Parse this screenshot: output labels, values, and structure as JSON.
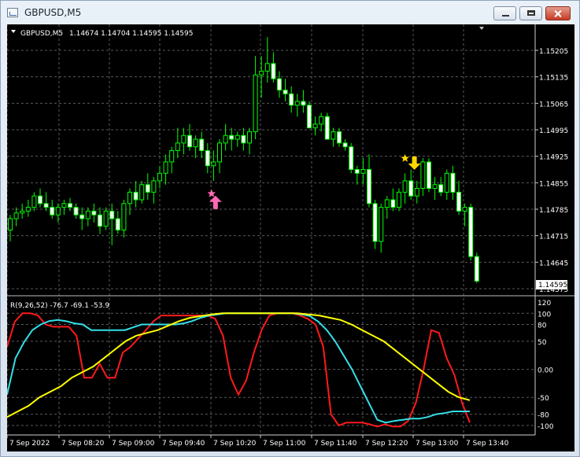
{
  "window": {
    "title": "GBPUSD,M5"
  },
  "colors": {
    "bull": "#00ff00",
    "bear": "#ffffff",
    "red": "#ff1a1a",
    "cyan": "#34e0e8",
    "yellow": "#ffff00",
    "pink": "#ff69b4",
    "gold": "#ffd700"
  },
  "header": {
    "symbol": "GBPUSD,M5",
    "ohlc": "1.14674 1.14704 1.14595 1.14595"
  },
  "price_axis": {
    "labels": [
      "1.15205",
      "1.15135",
      "1.15065",
      "1.14995",
      "1.14925",
      "1.14855",
      "1.14785",
      "1.14715",
      "1.14645",
      "1.14575"
    ],
    "current": "1.14595"
  },
  "indicator": {
    "label": "R(9,26,52) -76.7 -69.1 -53.9",
    "axis_labels": [
      "120",
      "100",
      "80",
      "50",
      "0.00",
      "-50",
      "-80",
      "-100"
    ]
  },
  "time_axis": [
    "7 Sep 2022",
    "7 Sep 08:20",
    "7 Sep 09:00",
    "7 Sep 09:40",
    "7 Sep 10:20",
    "7 Sep 11:00",
    "7 Sep 11:40",
    "7 Sep 12:20",
    "7 Sep 13:00",
    "7 Sep 13:40"
  ],
  "chart_data": {
    "type": "candlestick",
    "symbol": "GBPUSD",
    "timeframe": "M5",
    "candles": [
      [
        1.1473,
        1.1477,
        1.147,
        1.1476
      ],
      [
        1.1476,
        1.1479,
        1.1474,
        1.14775
      ],
      [
        1.14775,
        1.148,
        1.1476,
        1.1478
      ],
      [
        1.1478,
        1.1481,
        1.14765,
        1.1479
      ],
      [
        1.1479,
        1.1483,
        1.1478,
        1.1482
      ],
      [
        1.1482,
        1.1484,
        1.1479,
        1.148
      ],
      [
        1.148,
        1.1483,
        1.1478,
        1.1479
      ],
      [
        1.1479,
        1.1481,
        1.1476,
        1.1477
      ],
      [
        1.1477,
        1.148,
        1.1475,
        1.1479
      ],
      [
        1.1479,
        1.1481,
        1.1477,
        1.148
      ],
      [
        1.148,
        1.14815,
        1.1478,
        1.1479
      ],
      [
        1.1479,
        1.148,
        1.1476,
        1.1477
      ],
      [
        1.1477,
        1.1479,
        1.1473,
        1.1476
      ],
      [
        1.1476,
        1.1479,
        1.1474,
        1.1478
      ],
      [
        1.1478,
        1.148,
        1.1475,
        1.1477
      ],
      [
        1.1477,
        1.1479,
        1.1472,
        1.1474
      ],
      [
        1.1474,
        1.1479,
        1.1473,
        1.1478
      ],
      [
        1.1478,
        1.148,
        1.1469,
        1.1476
      ],
      [
        1.1476,
        1.1478,
        1.1472,
        1.1473
      ],
      [
        1.1473,
        1.1481,
        1.1471,
        1.148
      ],
      [
        1.148,
        1.1484,
        1.1477,
        1.1483
      ],
      [
        1.1483,
        1.1486,
        1.1479,
        1.1481
      ],
      [
        1.1481,
        1.1486,
        1.148,
        1.1485
      ],
      [
        1.1485,
        1.1488,
        1.1481,
        1.1483
      ],
      [
        1.1483,
        1.1487,
        1.148,
        1.1486
      ],
      [
        1.1486,
        1.149,
        1.1484,
        1.1488
      ],
      [
        1.1488,
        1.1493,
        1.1485,
        1.1491
      ],
      [
        1.1491,
        1.1495,
        1.1488,
        1.1494
      ],
      [
        1.1494,
        1.15,
        1.1492,
        1.1496
      ],
      [
        1.1496,
        1.15,
        1.1493,
        1.1498
      ],
      [
        1.1498,
        1.1501,
        1.1494,
        1.1495
      ],
      [
        1.1495,
        1.1498,
        1.1492,
        1.1497
      ],
      [
        1.1497,
        1.1499,
        1.1492,
        1.1494
      ],
      [
        1.1494,
        1.1496,
        1.1488,
        1.149
      ],
      [
        1.149,
        1.1494,
        1.1486,
        1.1491
      ],
      [
        1.1491,
        1.1497,
        1.1488,
        1.1496
      ],
      [
        1.1496,
        1.1501,
        1.1494,
        1.1498
      ],
      [
        1.1498,
        1.15,
        1.1494,
        1.1497
      ],
      [
        1.1497,
        1.1499,
        1.1495,
        1.1498
      ],
      [
        1.1498,
        1.15,
        1.1494,
        1.1496
      ],
      [
        1.1496,
        1.15,
        1.1493,
        1.1499
      ],
      [
        1.1499,
        1.1519,
        1.1497,
        1.1514
      ],
      [
        1.1514,
        1.1519,
        1.1508,
        1.1515
      ],
      [
        1.1515,
        1.1524,
        1.1512,
        1.1517
      ],
      [
        1.1517,
        1.152,
        1.1512,
        1.1513
      ],
      [
        1.1513,
        1.1515,
        1.1508,
        1.151
      ],
      [
        1.151,
        1.1513,
        1.1507,
        1.1509
      ],
      [
        1.1509,
        1.1511,
        1.1504,
        1.1506
      ],
      [
        1.1506,
        1.1509,
        1.1503,
        1.1507
      ],
      [
        1.1507,
        1.151,
        1.1504,
        1.1506
      ],
      [
        1.1506,
        1.1507,
        1.15,
        1.15
      ],
      [
        1.15,
        1.1503,
        1.1498,
        1.1501
      ],
      [
        1.1501,
        1.1504,
        1.1499,
        1.1503
      ],
      [
        1.1503,
        1.1504,
        1.1497,
        1.1497
      ],
      [
        1.1497,
        1.15,
        1.1495,
        1.1499
      ],
      [
        1.1499,
        1.15,
        1.1495,
        1.1496
      ],
      [
        1.1496,
        1.1497,
        1.1494,
        1.1495
      ],
      [
        1.1495,
        1.1496,
        1.1488,
        1.1489
      ],
      [
        1.1489,
        1.149,
        1.1485,
        1.1488
      ],
      [
        1.1488,
        1.1492,
        1.1485,
        1.1489
      ],
      [
        1.1489,
        1.1493,
        1.1479,
        1.148
      ],
      [
        1.148,
        1.1481,
        1.1468,
        1.147
      ],
      [
        1.147,
        1.148,
        1.1467,
        1.1479
      ],
      [
        1.1479,
        1.1482,
        1.1476,
        1.1481
      ],
      [
        1.1481,
        1.1484,
        1.1478,
        1.1479
      ],
      [
        1.1479,
        1.1484,
        1.1478,
        1.1483
      ],
      [
        1.1483,
        1.1488,
        1.148,
        1.1486
      ],
      [
        1.1486,
        1.1489,
        1.1481,
        1.1482
      ],
      [
        1.1482,
        1.1486,
        1.148,
        1.1484
      ],
      [
        1.1484,
        1.1492,
        1.1482,
        1.1491
      ],
      [
        1.1491,
        1.1492,
        1.1483,
        1.1484
      ],
      [
        1.1484,
        1.1487,
        1.1481,
        1.1485
      ],
      [
        1.1485,
        1.1487,
        1.1482,
        1.1483
      ],
      [
        1.1483,
        1.1489,
        1.1481,
        1.1488
      ],
      [
        1.1488,
        1.149,
        1.1481,
        1.1483
      ],
      [
        1.1483,
        1.1486,
        1.1477,
        1.1478
      ],
      [
        1.1478,
        1.148,
        1.1474,
        1.1479
      ],
      [
        1.1479,
        1.148,
        1.1465,
        1.1466
      ],
      [
        1.1466,
        1.1467,
        1.1459,
        1.14595
      ]
    ],
    "signals": [
      {
        "type": "buy-arrow",
        "candle": 33,
        "price": 1.148,
        "color": "pink"
      },
      {
        "type": "sell-arrow",
        "candle": 66,
        "price": 1.1491,
        "color": "gold"
      }
    ],
    "indicator": {
      "name": "R(9,26,52)",
      "ylim": [
        -110,
        120
      ],
      "levels": [
        100,
        80,
        50,
        0,
        -50,
        -80,
        -100
      ],
      "series": [
        {
          "color": "red",
          "values": [
            40,
            85,
            100,
            100,
            96,
            80,
            76,
            76,
            76,
            60,
            -15,
            -15,
            10,
            -15,
            -15,
            30,
            40,
            55,
            70,
            86,
            96,
            96,
            96,
            96,
            96,
            96,
            96,
            90,
            60,
            -15,
            -45,
            -20,
            30,
            70,
            96,
            100,
            100,
            100,
            96,
            90,
            80,
            40,
            -80,
            -100,
            -95,
            -95,
            -95,
            -98,
            -102,
            -98,
            -102,
            -102,
            -92,
            -60,
            0,
            70,
            65,
            20,
            -10,
            -60,
            -95
          ]
        },
        {
          "color": "cyan",
          "values": [
            -45,
            20,
            48,
            70,
            80,
            86,
            88,
            86,
            82,
            80,
            70,
            70,
            70,
            70,
            70,
            75,
            80,
            80,
            80,
            80,
            80,
            82,
            86,
            92,
            96,
            98,
            100,
            100,
            100,
            100,
            100,
            100,
            100,
            100,
            100,
            98,
            95,
            85,
            70,
            50,
            25,
            0,
            -30,
            -60,
            -90,
            -95,
            -92,
            -90,
            -88,
            -88,
            -85,
            -80,
            -78,
            -75,
            -75,
            -75
          ]
        },
        {
          "color": "yellow",
          "values": [
            -85,
            -75,
            -65,
            -50,
            -40,
            -30,
            -15,
            -5,
            5,
            20,
            35,
            50,
            60,
            65,
            70,
            78,
            86,
            92,
            95,
            98,
            100,
            100,
            100,
            100,
            100,
            100,
            100,
            100,
            98,
            96,
            92,
            88,
            80,
            70,
            60,
            50,
            35,
            20,
            5,
            -10,
            -25,
            -40,
            -50,
            -55
          ]
        }
      ]
    }
  }
}
